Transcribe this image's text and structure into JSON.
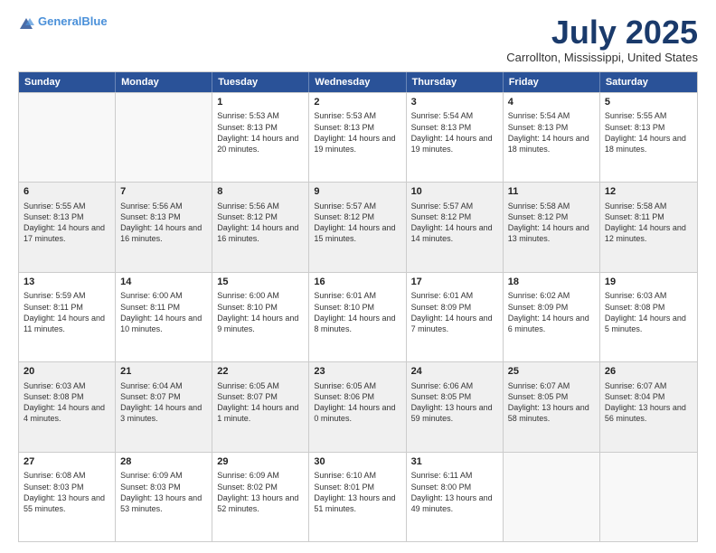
{
  "header": {
    "logo_line1": "General",
    "logo_line2": "Blue",
    "title": "July 2025",
    "location": "Carrollton, Mississippi, United States"
  },
  "weekdays": [
    "Sunday",
    "Monday",
    "Tuesday",
    "Wednesday",
    "Thursday",
    "Friday",
    "Saturday"
  ],
  "weeks": [
    [
      {
        "day": "",
        "info": ""
      },
      {
        "day": "",
        "info": ""
      },
      {
        "day": "1",
        "info": "Sunrise: 5:53 AM\nSunset: 8:13 PM\nDaylight: 14 hours and 20 minutes."
      },
      {
        "day": "2",
        "info": "Sunrise: 5:53 AM\nSunset: 8:13 PM\nDaylight: 14 hours and 19 minutes."
      },
      {
        "day": "3",
        "info": "Sunrise: 5:54 AM\nSunset: 8:13 PM\nDaylight: 14 hours and 19 minutes."
      },
      {
        "day": "4",
        "info": "Sunrise: 5:54 AM\nSunset: 8:13 PM\nDaylight: 14 hours and 18 minutes."
      },
      {
        "day": "5",
        "info": "Sunrise: 5:55 AM\nSunset: 8:13 PM\nDaylight: 14 hours and 18 minutes."
      }
    ],
    [
      {
        "day": "6",
        "info": "Sunrise: 5:55 AM\nSunset: 8:13 PM\nDaylight: 14 hours and 17 minutes."
      },
      {
        "day": "7",
        "info": "Sunrise: 5:56 AM\nSunset: 8:13 PM\nDaylight: 14 hours and 16 minutes."
      },
      {
        "day": "8",
        "info": "Sunrise: 5:56 AM\nSunset: 8:12 PM\nDaylight: 14 hours and 16 minutes."
      },
      {
        "day": "9",
        "info": "Sunrise: 5:57 AM\nSunset: 8:12 PM\nDaylight: 14 hours and 15 minutes."
      },
      {
        "day": "10",
        "info": "Sunrise: 5:57 AM\nSunset: 8:12 PM\nDaylight: 14 hours and 14 minutes."
      },
      {
        "day": "11",
        "info": "Sunrise: 5:58 AM\nSunset: 8:12 PM\nDaylight: 14 hours and 13 minutes."
      },
      {
        "day": "12",
        "info": "Sunrise: 5:58 AM\nSunset: 8:11 PM\nDaylight: 14 hours and 12 minutes."
      }
    ],
    [
      {
        "day": "13",
        "info": "Sunrise: 5:59 AM\nSunset: 8:11 PM\nDaylight: 14 hours and 11 minutes."
      },
      {
        "day": "14",
        "info": "Sunrise: 6:00 AM\nSunset: 8:11 PM\nDaylight: 14 hours and 10 minutes."
      },
      {
        "day": "15",
        "info": "Sunrise: 6:00 AM\nSunset: 8:10 PM\nDaylight: 14 hours and 9 minutes."
      },
      {
        "day": "16",
        "info": "Sunrise: 6:01 AM\nSunset: 8:10 PM\nDaylight: 14 hours and 8 minutes."
      },
      {
        "day": "17",
        "info": "Sunrise: 6:01 AM\nSunset: 8:09 PM\nDaylight: 14 hours and 7 minutes."
      },
      {
        "day": "18",
        "info": "Sunrise: 6:02 AM\nSunset: 8:09 PM\nDaylight: 14 hours and 6 minutes."
      },
      {
        "day": "19",
        "info": "Sunrise: 6:03 AM\nSunset: 8:08 PM\nDaylight: 14 hours and 5 minutes."
      }
    ],
    [
      {
        "day": "20",
        "info": "Sunrise: 6:03 AM\nSunset: 8:08 PM\nDaylight: 14 hours and 4 minutes."
      },
      {
        "day": "21",
        "info": "Sunrise: 6:04 AM\nSunset: 8:07 PM\nDaylight: 14 hours and 3 minutes."
      },
      {
        "day": "22",
        "info": "Sunrise: 6:05 AM\nSunset: 8:07 PM\nDaylight: 14 hours and 1 minute."
      },
      {
        "day": "23",
        "info": "Sunrise: 6:05 AM\nSunset: 8:06 PM\nDaylight: 14 hours and 0 minutes."
      },
      {
        "day": "24",
        "info": "Sunrise: 6:06 AM\nSunset: 8:05 PM\nDaylight: 13 hours and 59 minutes."
      },
      {
        "day": "25",
        "info": "Sunrise: 6:07 AM\nSunset: 8:05 PM\nDaylight: 13 hours and 58 minutes."
      },
      {
        "day": "26",
        "info": "Sunrise: 6:07 AM\nSunset: 8:04 PM\nDaylight: 13 hours and 56 minutes."
      }
    ],
    [
      {
        "day": "27",
        "info": "Sunrise: 6:08 AM\nSunset: 8:03 PM\nDaylight: 13 hours and 55 minutes."
      },
      {
        "day": "28",
        "info": "Sunrise: 6:09 AM\nSunset: 8:03 PM\nDaylight: 13 hours and 53 minutes."
      },
      {
        "day": "29",
        "info": "Sunrise: 6:09 AM\nSunset: 8:02 PM\nDaylight: 13 hours and 52 minutes."
      },
      {
        "day": "30",
        "info": "Sunrise: 6:10 AM\nSunset: 8:01 PM\nDaylight: 13 hours and 51 minutes."
      },
      {
        "day": "31",
        "info": "Sunrise: 6:11 AM\nSunset: 8:00 PM\nDaylight: 13 hours and 49 minutes."
      },
      {
        "day": "",
        "info": ""
      },
      {
        "day": "",
        "info": ""
      }
    ]
  ]
}
